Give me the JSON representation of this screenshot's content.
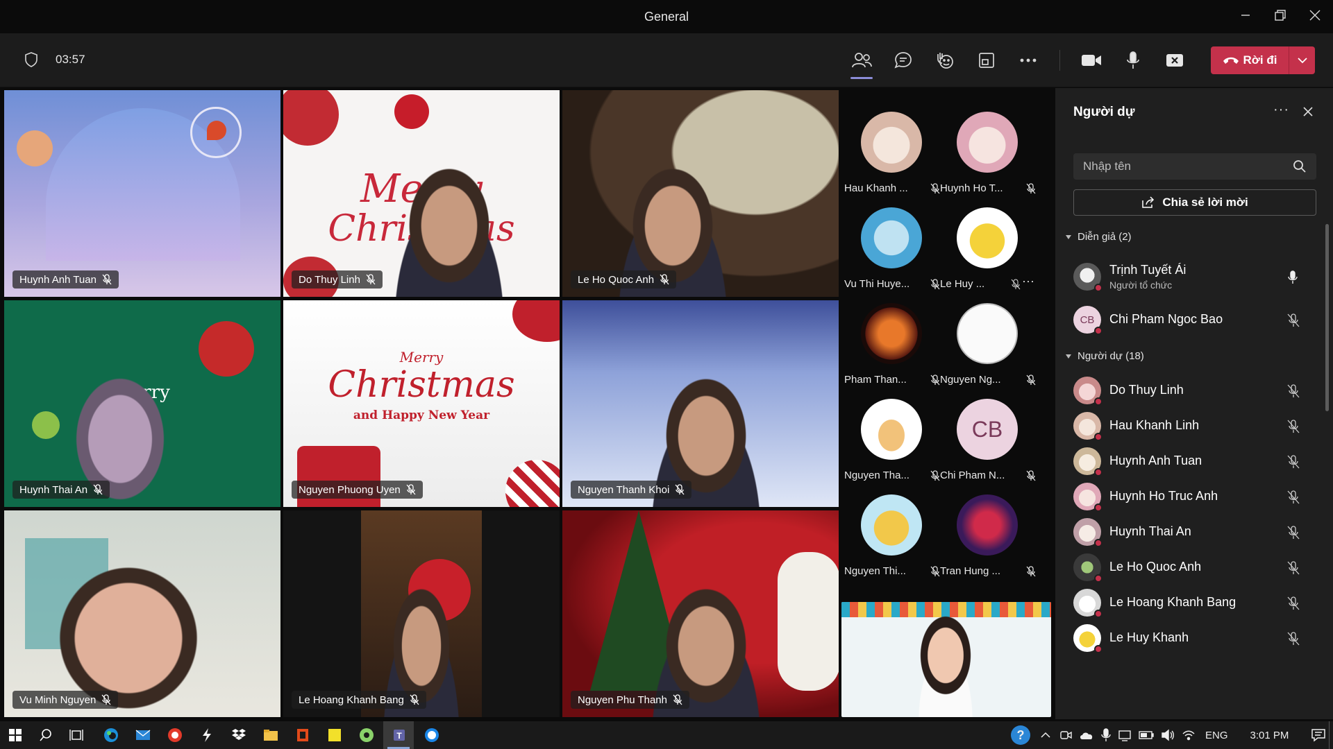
{
  "window": {
    "title": "General"
  },
  "meeting": {
    "timer": "03:57",
    "leave_label": "Rời đi"
  },
  "tiles": [
    {
      "name": "Huynh Anh Tuan"
    },
    {
      "name": "Do Thuy Linh",
      "bg_text1": "Merry",
      "bg_text2": "Christmas"
    },
    {
      "name": "Le Ho Quoc Anh"
    },
    {
      "name": "Huynh Thai An",
      "bg_text1": "merry"
    },
    {
      "name": "Nguyen Phuong Uyen",
      "bg_text1": "Merry",
      "bg_text2": "Christmas",
      "bg_text3": "and Happy New Year"
    },
    {
      "name": "Nguyen Thanh Khoi"
    },
    {
      "name": "Vu Minh Nguyen"
    },
    {
      "name": "Le Hoang Khanh Bang"
    },
    {
      "name": "Nguyen Phu Thanh"
    }
  ],
  "avatars": [
    {
      "label": "Hau Khanh ..."
    },
    {
      "label": "Huynh Ho T..."
    },
    {
      "label": "Vu Thi Huye..."
    },
    {
      "label": "Le Huy ...",
      "more": "···"
    },
    {
      "label": "Pham Than..."
    },
    {
      "label": "Nguyen Ng..."
    },
    {
      "label": "Nguyen Tha..."
    },
    {
      "label": "Chi Pham N...",
      "initials": "CB"
    },
    {
      "label": "Nguyen Thi..."
    },
    {
      "label": "Tran Hung ..."
    }
  ],
  "panel": {
    "title": "Người dự",
    "more": "···",
    "search_placeholder": "Nhập tên",
    "share_label": "Chia sẻ lời mời",
    "presenters_header": "Diễn giả (2)",
    "attendees_header": "Người dự (18)",
    "presenters": [
      {
        "name": "Trịnh Tuyết Ái",
        "role": "Người tổ chức"
      },
      {
        "name": "Chi Pham Ngoc Bao",
        "initials": "CB"
      }
    ],
    "attendees": [
      {
        "name": "Do Thuy Linh"
      },
      {
        "name": "Hau Khanh Linh"
      },
      {
        "name": "Huynh Anh Tuan"
      },
      {
        "name": "Huynh Ho Truc Anh"
      },
      {
        "name": "Huynh Thai An"
      },
      {
        "name": "Le Ho Quoc Anh"
      },
      {
        "name": "Le Hoang Khanh Bang"
      },
      {
        "name": "Le Huy Khanh"
      }
    ]
  },
  "taskbar": {
    "language": "ENG",
    "clock": "3:01 PM",
    "help_glyph": "?"
  },
  "colors": {
    "leave": "#c4314b",
    "accent": "#8b8cd8",
    "panel_bg": "#1f1f1f"
  }
}
